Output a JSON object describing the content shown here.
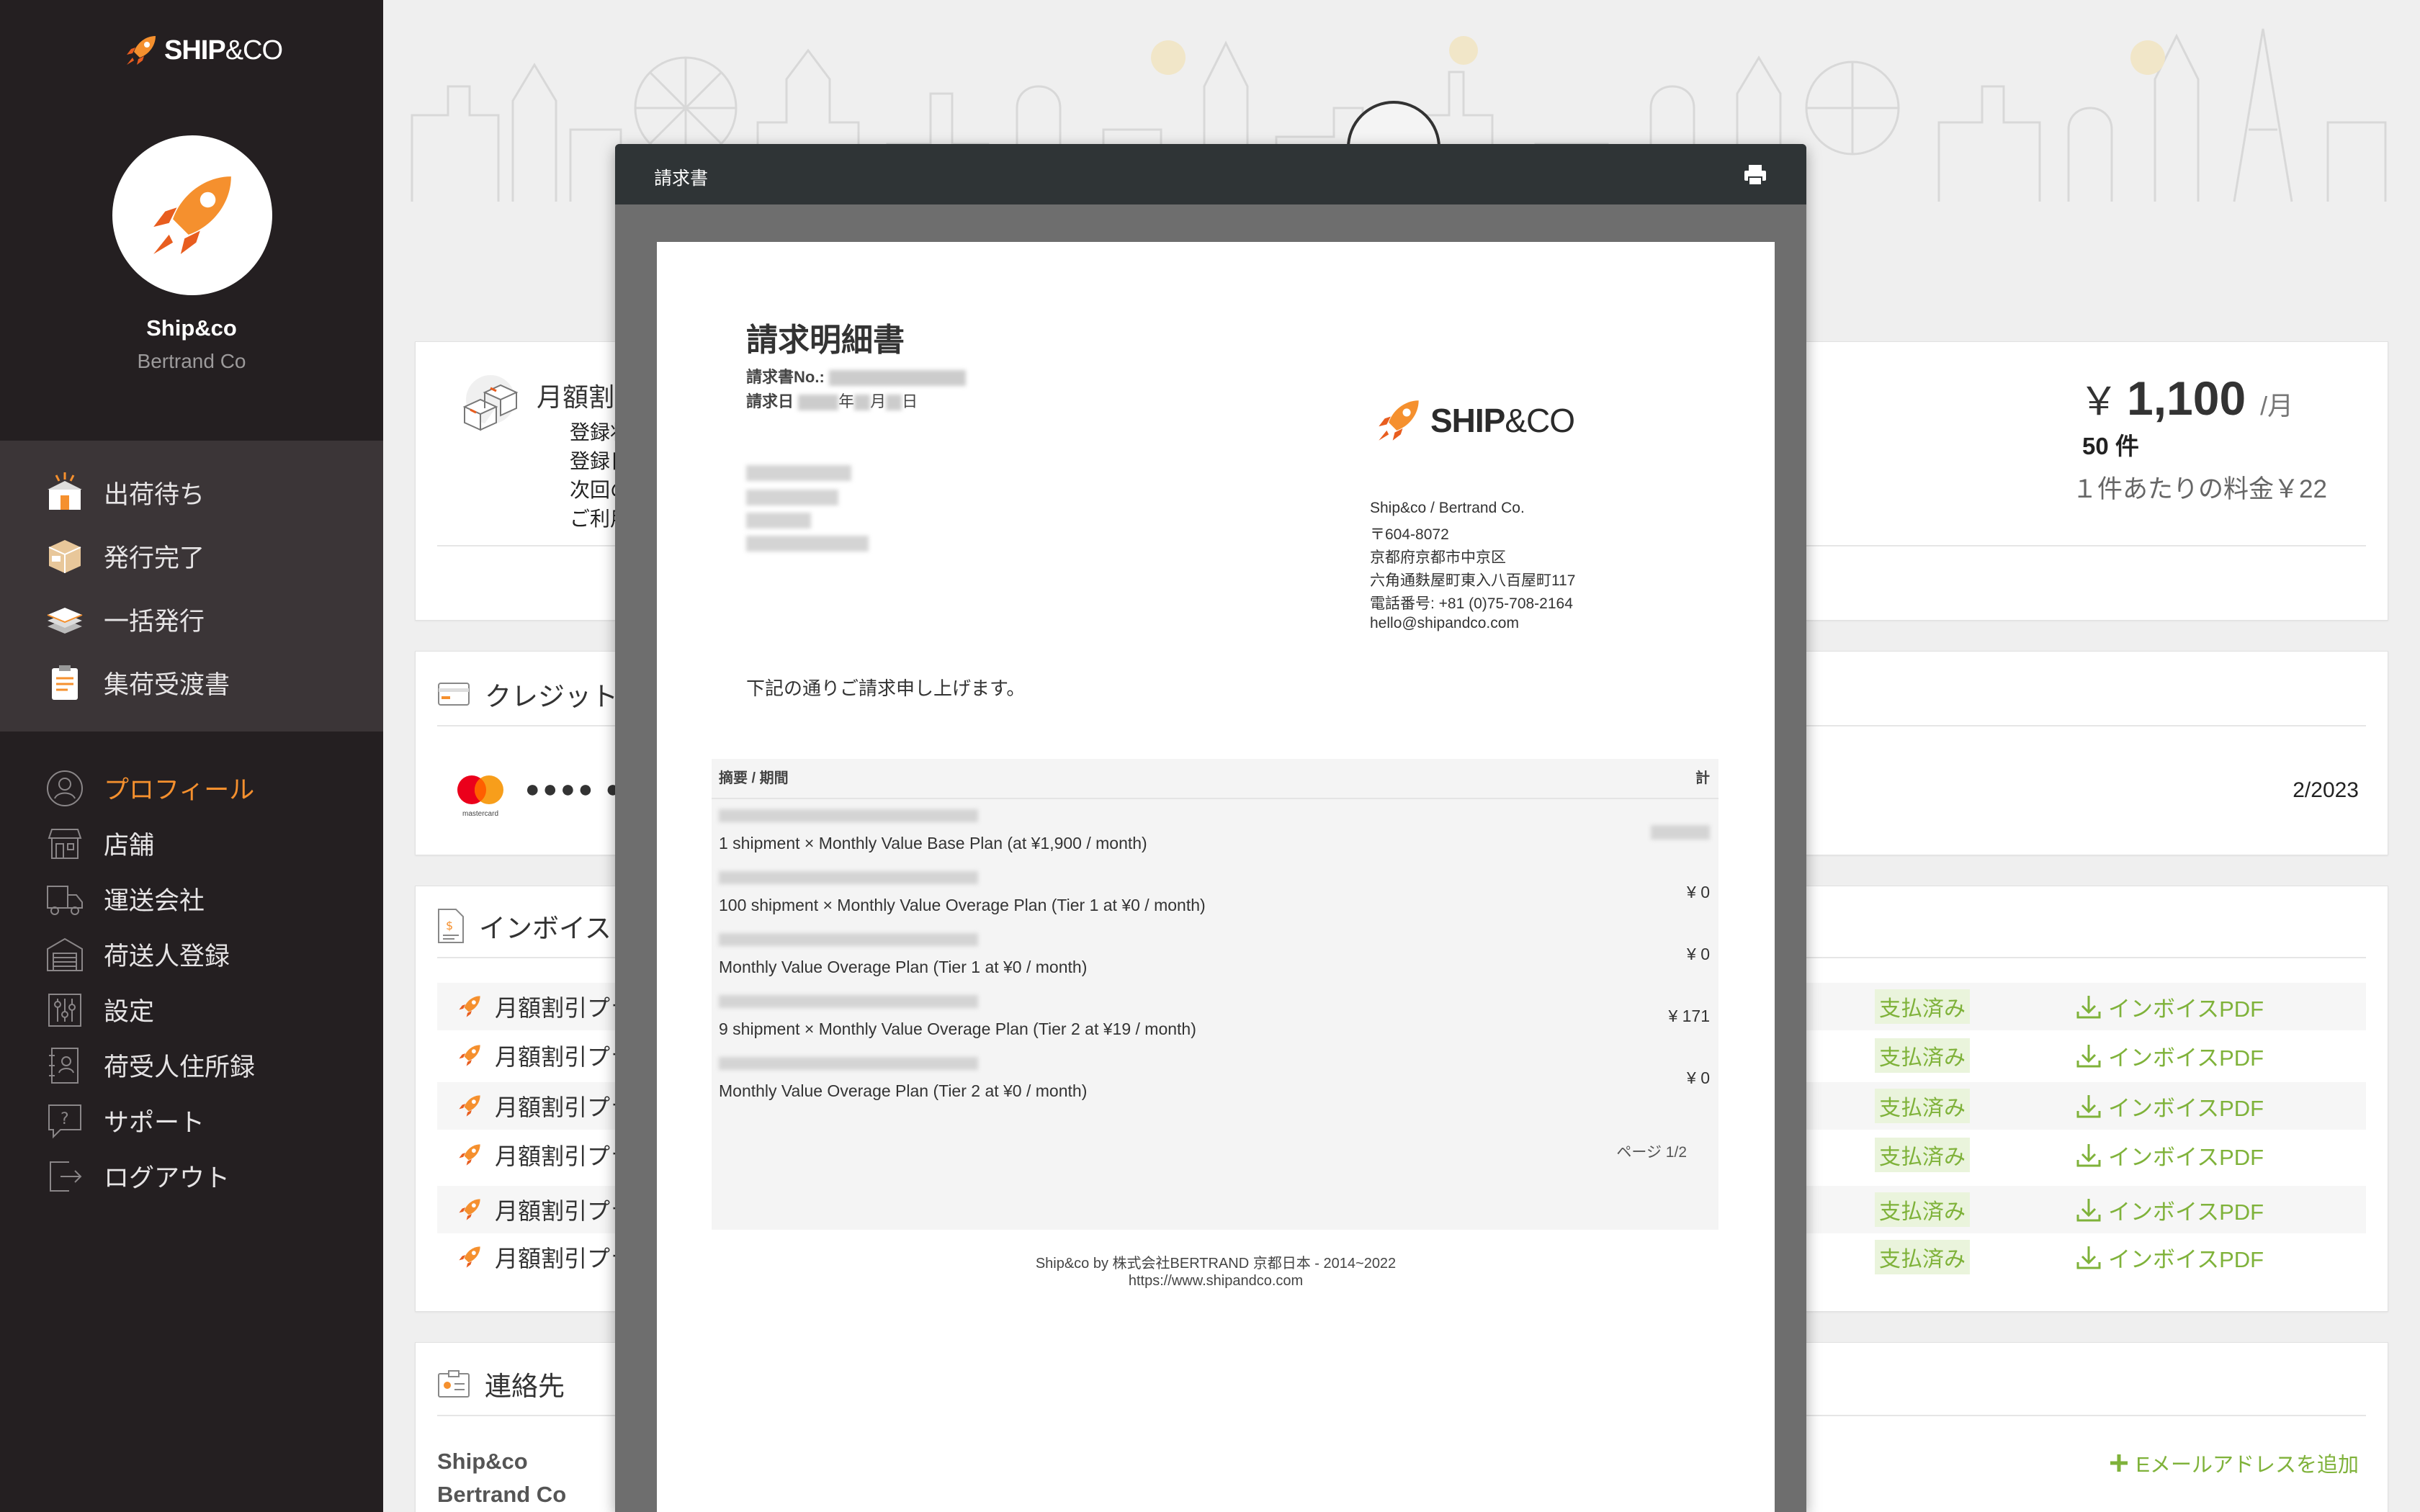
{
  "sidebar": {
    "brand_main": "SHIP",
    "brand_co": "&CO",
    "user_name": "Ship&co",
    "company": "Bertrand Co",
    "group1": [
      {
        "label": "出荷待ち",
        "icon": "shipment-box-icon"
      },
      {
        "label": "発行完了",
        "icon": "package-icon"
      },
      {
        "label": "一括発行",
        "icon": "stack-icon"
      },
      {
        "label": "集荷受渡書",
        "icon": "clipboard-icon"
      }
    ],
    "group2": [
      {
        "label": "プロフィール",
        "icon": "profile-icon"
      },
      {
        "label": "店舗",
        "icon": "store-icon"
      },
      {
        "label": "運送会社",
        "icon": "truck-icon"
      },
      {
        "label": "荷送人登録",
        "icon": "warehouse-icon"
      },
      {
        "label": "設定",
        "icon": "settings-sliders-icon"
      },
      {
        "label": "荷受人住所録",
        "icon": "address-book-icon"
      },
      {
        "label": "サポート",
        "icon": "support-icon"
      },
      {
        "label": "ログアウト",
        "icon": "logout-icon"
      }
    ]
  },
  "plan_card": {
    "title": "月額割",
    "line1": "登録状況",
    "line2": "登録日: 2",
    "line3": "次回の請",
    "line4": "ご利用件",
    "price_symbol": "￥",
    "price_amount": "1,100",
    "price_per": "/月",
    "count": "50 件",
    "unit_price": "１件あたりの料金￥22"
  },
  "credit_card": {
    "title": "クレジット",
    "masked": "●●●● ●●",
    "brand": "mastercard",
    "expiry": "2/2023"
  },
  "invoice_card": {
    "title": "インボイス",
    "rows": [
      {
        "name": "月額割引プラ",
        "status": "支払済み",
        "pdf": "インボイスPDF"
      },
      {
        "name": "月額割引プラ",
        "status": "支払済み",
        "pdf": "インボイスPDF"
      },
      {
        "name": "月額割引プラ",
        "status": "支払済み",
        "pdf": "インボイスPDF"
      },
      {
        "name": "月額割引プラ",
        "status": "支払済み",
        "pdf": "インボイスPDF"
      },
      {
        "name": "月額割引プラ",
        "status": "支払済み",
        "pdf": "インボイスPDF"
      },
      {
        "name": "月額割引プラ",
        "status": "支払済み",
        "pdf": "インボイスPDF"
      }
    ]
  },
  "contact_card": {
    "title": "連絡先",
    "name": "Ship&co",
    "company": "Bertrand Co",
    "add_email": "Eメールアドレスを追加"
  },
  "modal": {
    "title": "請求書",
    "doc": {
      "heading": "請求明細書",
      "invoice_no_label": "請求書No.:",
      "date_label": "請求日",
      "date_mid1": "年",
      "date_mid2": "月",
      "date_end": "日",
      "brand_main": "SHIP",
      "brand_co": "&CO",
      "address": [
        "Ship&co / Bertrand Co.",
        "〒604-8072",
        "京都府京都市中京区",
        "六角通麩屋町東入八百屋町117",
        "電話番号: +81 (0)75-708-2164",
        "hello@shipandco.com"
      ],
      "intro": "下記の通りご請求申し上げます。",
      "col_desc": "摘要 / 期間",
      "col_total": "計",
      "line_items": [
        {
          "desc": "1 shipment × Monthly Value Base Plan (at ¥1,900 / month)",
          "amount": ""
        },
        {
          "desc": "100 shipment × Monthly Value Overage Plan (Tier 1 at ¥0 / month)",
          "amount": "¥ 0"
        },
        {
          "desc": "Monthly Value Overage Plan (Tier 1 at ¥0 / month)",
          "amount": "¥ 0"
        },
        {
          "desc": "9 shipment × Monthly Value Overage Plan (Tier 2 at ¥19 / month)",
          "amount": "¥ 171"
        },
        {
          "desc": "Monthly Value Overage Plan (Tier 2 at ¥0 / month)",
          "amount": "¥ 0"
        }
      ],
      "page": "ページ 1/2",
      "footer1": "Ship&co by 株式会社BERTRAND 京都日本 - 2014~2022",
      "footer2": "https://www.shipandco.com"
    }
  },
  "colors": {
    "sidebar_bg": "#241f21",
    "accent_orange": "#f5902e",
    "paid_green": "#7fb23a",
    "modal_header": "#2f3436"
  }
}
